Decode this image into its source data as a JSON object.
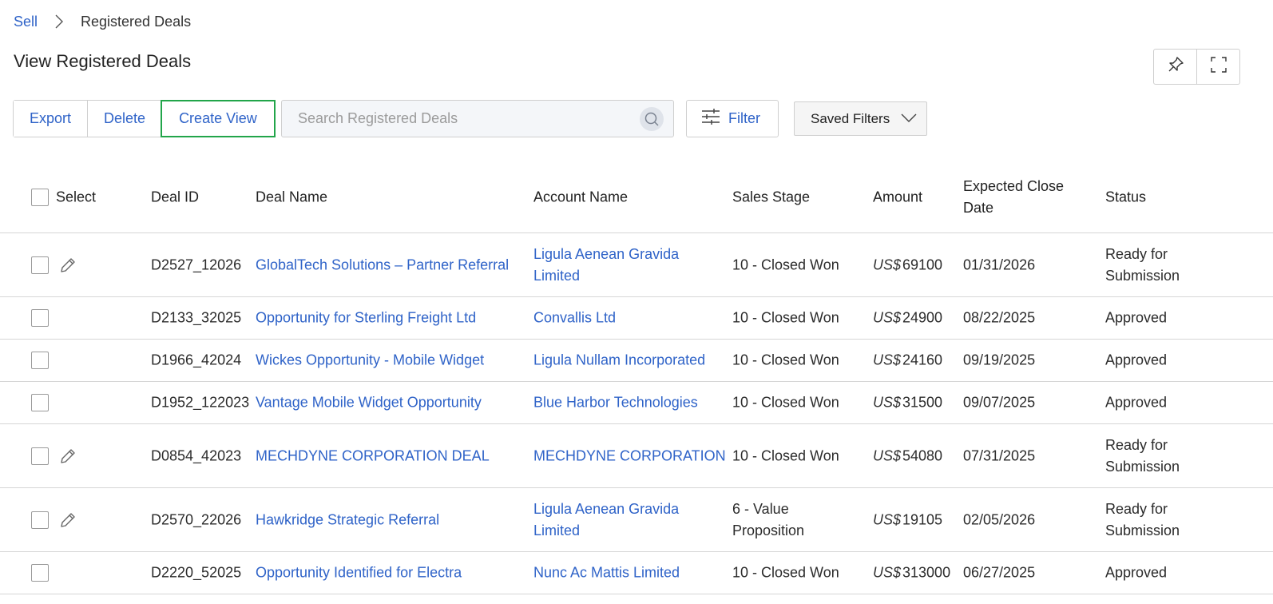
{
  "breadcrumb": {
    "root": "Sell",
    "current": "Registered Deals"
  },
  "page_title": "View Registered Deals",
  "toolbar": {
    "export_label": "Export",
    "delete_label": "Delete",
    "create_view_label": "Create View",
    "search_placeholder": "Search Registered Deals",
    "filter_label": "Filter",
    "saved_filters_label": "Saved Filters"
  },
  "table": {
    "headers": {
      "select": "Select",
      "deal_id": "Deal ID",
      "deal_name": "Deal Name",
      "account_name": "Account Name",
      "sales_stage": "Sales Stage",
      "amount": "Amount",
      "close_date_1": "Expected Close",
      "close_date_2": "Date",
      "status": "Status"
    },
    "currency_prefix": "US$",
    "rows": [
      {
        "editable": true,
        "deal_id": "D2527_12026",
        "deal_name": "GlobalTech Solutions – Partner Referral",
        "account_1": "Ligula Aenean Gravida",
        "account_2": "Limited",
        "stage_1": "10 - Closed Won",
        "stage_2": "",
        "amount": "69100",
        "close_date": "01/31/2026",
        "status_1": "Ready for",
        "status_2": "Submission"
      },
      {
        "editable": false,
        "deal_id": "D2133_32025",
        "deal_name": "Opportunity for Sterling Freight Ltd",
        "account_1": "Convallis Ltd",
        "account_2": "",
        "stage_1": "10 - Closed Won",
        "stage_2": "",
        "amount": "24900",
        "close_date": "08/22/2025",
        "status_1": "Approved",
        "status_2": ""
      },
      {
        "editable": false,
        "deal_id": "D1966_42024",
        "deal_name": "Wickes Opportunity - Mobile Widget",
        "account_1": "Ligula Nullam Incorporated",
        "account_2": "",
        "stage_1": "10 - Closed Won",
        "stage_2": "",
        "amount": "24160",
        "close_date": "09/19/2025",
        "status_1": "Approved",
        "status_2": ""
      },
      {
        "editable": false,
        "deal_id": "D1952_122023",
        "deal_name": "Vantage Mobile Widget Opportunity",
        "account_1": "Blue Harbor Technologies",
        "account_2": "",
        "stage_1": "10 - Closed Won",
        "stage_2": "",
        "amount": "31500",
        "close_date": "09/07/2025",
        "status_1": "Approved",
        "status_2": ""
      },
      {
        "editable": true,
        "deal_id": "D0854_42023",
        "deal_name": "MECHDYNE CORPORATION DEAL",
        "account_1": "MECHDYNE CORPORATION",
        "account_2": "",
        "stage_1": "10 - Closed Won",
        "stage_2": "",
        "amount": "54080",
        "close_date": "07/31/2025",
        "status_1": "Ready for",
        "status_2": "Submission"
      },
      {
        "editable": true,
        "deal_id": "D2570_22026",
        "deal_name": "Hawkridge Strategic Referral",
        "account_1": "Ligula Aenean Gravida",
        "account_2": "Limited",
        "stage_1": "6 - Value",
        "stage_2": "Proposition",
        "amount": "19105",
        "close_date": "02/05/2026",
        "status_1": "Ready for",
        "status_2": "Submission"
      },
      {
        "editable": false,
        "deal_id": "D2220_52025",
        "deal_name": "Opportunity Identified for Electra",
        "account_1": "Nunc Ac Mattis Limited",
        "account_2": "",
        "stage_1": "10 - Closed Won",
        "stage_2": "",
        "amount": "313000",
        "close_date": "06/27/2025",
        "status_1": "Approved",
        "status_2": ""
      }
    ]
  }
}
